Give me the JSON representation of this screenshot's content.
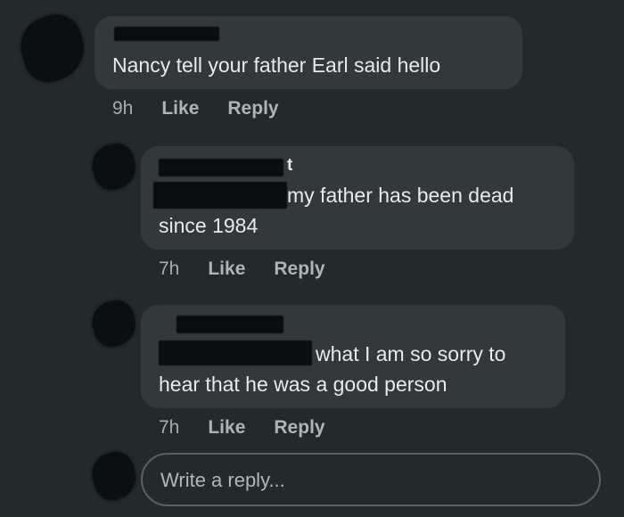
{
  "comments": [
    {
      "body": "Nancy tell your father Earl said hello",
      "time": "9h",
      "like_label": "Like",
      "reply_label": "Reply"
    },
    {
      "name_fragment": "t",
      "body_line1": "my father has been dead",
      "body_line2": "since 1984",
      "time": "7h",
      "like_label": "Like",
      "reply_label": "Reply"
    },
    {
      "body_line1": "what I am so sorry to",
      "body_line2": "hear that he was a good person",
      "time": "7h",
      "like_label": "Like",
      "reply_label": "Reply"
    }
  ],
  "reply_input": {
    "placeholder": "Write a reply..."
  },
  "colors": {
    "background": "#222a2a",
    "bubble": "#33383a",
    "text": "#e8e9ec",
    "meta": "#a9abaf"
  }
}
